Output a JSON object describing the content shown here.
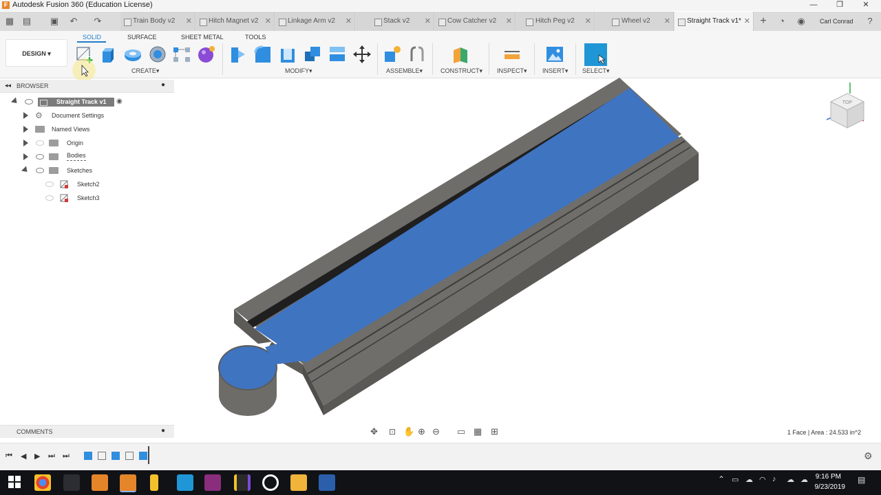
{
  "window": {
    "title": "Autodesk Fusion 360 (Education License)",
    "app_icon_glyph": "F",
    "minimize": "—",
    "maximize": "❐",
    "close": "✕"
  },
  "tabs": [
    {
      "label": "Train Body v2",
      "active": false
    },
    {
      "label": "Hitch Magnet v2",
      "active": false
    },
    {
      "label": "Linkage Arm v2",
      "active": false
    },
    {
      "label": "Stack v2",
      "active": false
    },
    {
      "label": "Cow Catcher v2",
      "active": false
    },
    {
      "label": "Hitch Peg v2",
      "active": false
    },
    {
      "label": "Wheel v2",
      "active": false
    },
    {
      "label": "Straight Track v1*",
      "active": true
    }
  ],
  "tab_close_glyph": "✕",
  "user": {
    "name": "Carl Conrad"
  },
  "ribbon": {
    "tabs": [
      "SOLID",
      "SURFACE",
      "SHEET METAL",
      "TOOLS"
    ],
    "active_tab": "SOLID",
    "workspace": "DESIGN",
    "groups": [
      "CREATE",
      "MODIFY",
      "ASSEMBLE",
      "CONSTRUCT",
      "INSPECT",
      "INSERT",
      "SELECT"
    ],
    "caret": "▾"
  },
  "browser": {
    "title": "BROWSER",
    "root": "Straight Track v1",
    "items": [
      {
        "label": "Document Settings",
        "icon": "gear-icon"
      },
      {
        "label": "Named Views",
        "icon": "folder-icon"
      },
      {
        "label": "Origin",
        "icon": "folder-icon"
      },
      {
        "label": "Bodies",
        "icon": "folder-icon"
      },
      {
        "label": "Sketches",
        "icon": "folder-icon"
      }
    ],
    "sketches": [
      "Sketch2",
      "Sketch3"
    ]
  },
  "comments": {
    "title": "COMMENTS"
  },
  "status": {
    "selection": "1 Face | Area : 24.533 in^2"
  },
  "viewcube": {
    "face_label": "TOP"
  },
  "taskbar": {
    "time": "9:16 PM",
    "date": "9/23/2019"
  },
  "colors": {
    "accent": "#1f7bc8",
    "selected_face": "#3f74c1",
    "track_body": "#6e6c68",
    "taskbar": "#101216"
  }
}
